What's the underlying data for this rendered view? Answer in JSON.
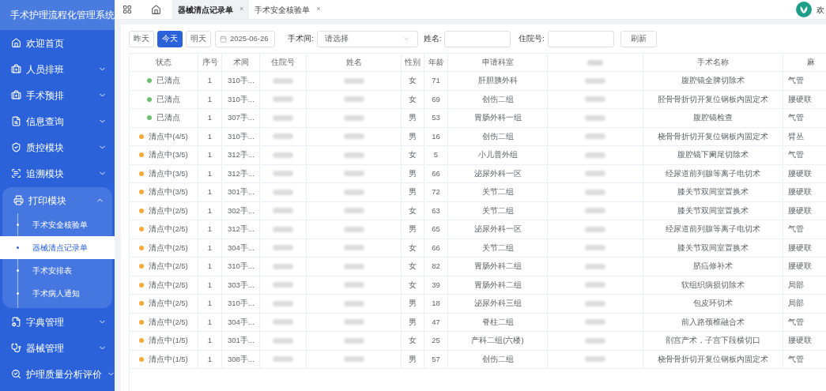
{
  "app": {
    "title": "手术护理流程化管理系统"
  },
  "sidebar": {
    "items": [
      {
        "label": "欢迎首页",
        "has_children": false,
        "expanded": false
      },
      {
        "label": "人员排班",
        "has_children": true,
        "expanded": false
      },
      {
        "label": "手术预排",
        "has_children": true,
        "expanded": false
      },
      {
        "label": "信息查询",
        "has_children": true,
        "expanded": false
      },
      {
        "label": "质控模块",
        "has_children": true,
        "expanded": false
      },
      {
        "label": "追溯模块",
        "has_children": true,
        "expanded": false
      },
      {
        "label": "打印模块",
        "has_children": true,
        "expanded": true,
        "children": [
          {
            "label": "手术安全核验单",
            "selected": false
          },
          {
            "label": "器械清点记录单",
            "selected": true
          },
          {
            "label": "手术安排表",
            "selected": false
          },
          {
            "label": "手术病人通知",
            "selected": false
          }
        ]
      },
      {
        "label": "字典管理",
        "has_children": true,
        "expanded": false
      },
      {
        "label": "器械管理",
        "has_children": true,
        "expanded": false
      },
      {
        "label": "护理质量分析评价",
        "has_children": true,
        "expanded": false
      }
    ]
  },
  "tabs": [
    {
      "label": "器械清点记录单",
      "selected": true,
      "close": "×"
    },
    {
      "label": "手术安全核验单",
      "selected": false,
      "close": "×"
    }
  ],
  "user": {
    "greeting": "欢"
  },
  "filters": {
    "day_buttons": [
      {
        "label": "昨天",
        "selected": false
      },
      {
        "label": "今天",
        "selected": true
      },
      {
        "label": "明天",
        "selected": false
      }
    ],
    "date": "2025-06-26",
    "room_label": "手术间:",
    "room_placeholder": "请选择",
    "name_label": "姓名:",
    "inpatient_label": "住院号:",
    "refresh": "刷新"
  },
  "table": {
    "columns": [
      {
        "label": "状态",
        "kind": "text"
      },
      {
        "label": "序号",
        "kind": "text"
      },
      {
        "label": "术间",
        "kind": "text"
      },
      {
        "label": "住院号",
        "kind": "text"
      },
      {
        "label": "姓名",
        "kind": "text"
      },
      {
        "label": "性别",
        "kind": "text"
      },
      {
        "label": "年龄",
        "kind": "text"
      },
      {
        "label": "申请科室",
        "kind": "text"
      },
      {
        "kind": "blurred"
      },
      {
        "label": "手术名称",
        "kind": "text"
      },
      {
        "label": "麻",
        "kind": "text"
      }
    ],
    "rows": [
      {
        "status": "已清点",
        "color": "#6cc070",
        "seq": "1",
        "room": "310手...",
        "gender": "女",
        "age": "71",
        "dept": "肝胆胰外科",
        "surgery": "腹腔镜全脾切除术",
        "anesthesia": "气管"
      },
      {
        "status": "已清点",
        "color": "#6cc070",
        "seq": "1",
        "room": "310手...",
        "gender": "女",
        "age": "69",
        "dept": "创伤二组",
        "surgery": "胫骨骨折切开复位钢板内固定术",
        "anesthesia": "腰硬联"
      },
      {
        "status": "已清点",
        "color": "#6cc070",
        "seq": "1",
        "room": "307手...",
        "gender": "男",
        "age": "53",
        "dept": "胃肠外科一组",
        "surgery": "腹腔镜检查",
        "anesthesia": "气管"
      },
      {
        "status": "清点中(4/5)",
        "color": "#f7a83a",
        "seq": "1",
        "room": "310手...",
        "gender": "男",
        "age": "16",
        "dept": "创伤二组",
        "surgery": "桡骨骨折切开复位钢板内固定术",
        "anesthesia": "臂丛"
      },
      {
        "status": "清点中(3/5)",
        "color": "#f7a83a",
        "seq": "1",
        "room": "312手...",
        "gender": "女",
        "age": "5",
        "dept": "小儿普外组",
        "surgery": "腹腔镜下阑尾切除术",
        "anesthesia": "气管"
      },
      {
        "status": "清点中(3/5)",
        "color": "#f7a83a",
        "seq": "1",
        "room": "312手...",
        "gender": "男",
        "age": "66",
        "dept": "泌尿外科一区",
        "surgery": "经尿道前列腺等离子电切术",
        "anesthesia": "腰硬联"
      },
      {
        "status": "清点中(3/5)",
        "color": "#f7a83a",
        "seq": "1",
        "room": "301手...",
        "gender": "男",
        "age": "72",
        "dept": "关节二组",
        "surgery": "膝关节双间室置换术",
        "anesthesia": "腰硬联"
      },
      {
        "status": "清点中(2/5)",
        "color": "#f7a83a",
        "seq": "1",
        "room": "302手...",
        "gender": "女",
        "age": "63",
        "dept": "关节二组",
        "surgery": "膝关节双间室置换术",
        "anesthesia": "腰硬联"
      },
      {
        "status": "清点中(2/5)",
        "color": "#f7a83a",
        "seq": "1",
        "room": "312手...",
        "gender": "男",
        "age": "65",
        "dept": "泌尿外科一区",
        "surgery": "经尿道前列腺等离子电切术",
        "anesthesia": "气管"
      },
      {
        "status": "清点中(2/5)",
        "color": "#f7a83a",
        "seq": "1",
        "room": "304手...",
        "gender": "女",
        "age": "66",
        "dept": "关节二组",
        "surgery": "膝关节双间室置换术",
        "anesthesia": "腰硬联"
      },
      {
        "status": "清点中(2/5)",
        "color": "#f7a83a",
        "seq": "1",
        "room": "310手...",
        "gender": "女",
        "age": "82",
        "dept": "胃肠外科二组",
        "surgery": "脐疝修补术",
        "anesthesia": "腰硬联"
      },
      {
        "status": "清点中(2/5)",
        "color": "#f7a83a",
        "seq": "1",
        "room": "303手...",
        "gender": "女",
        "age": "39",
        "dept": "胃肠外科二组",
        "surgery": "软组织病损切除术",
        "anesthesia": "局部"
      },
      {
        "status": "清点中(2/5)",
        "color": "#f7a83a",
        "seq": "1",
        "room": "310手...",
        "gender": "男",
        "age": "18",
        "dept": "泌尿外科三组",
        "surgery": "包皮环切术",
        "anesthesia": "局部"
      },
      {
        "status": "清点中(2/5)",
        "color": "#f7a83a",
        "seq": "1",
        "room": "304手...",
        "gender": "男",
        "age": "47",
        "dept": "脊柱二组",
        "surgery": "前入路颈椎融合术",
        "anesthesia": "气管"
      },
      {
        "status": "清点中(1/5)",
        "color": "#f7a83a",
        "seq": "1",
        "room": "301手...",
        "gender": "女",
        "age": "25",
        "dept": "产科二组(六楼)",
        "surgery": "剖宫产术，子宫下段横切口",
        "anesthesia": "腰硬联"
      },
      {
        "status": "清点中(1/5)",
        "color": "#f7a83a",
        "seq": "1",
        "room": "308手...",
        "gender": "男",
        "age": "57",
        "dept": "创伤二组",
        "surgery": "桡骨骨折切开复位钢板内固定术",
        "anesthesia": "气管"
      }
    ]
  }
}
